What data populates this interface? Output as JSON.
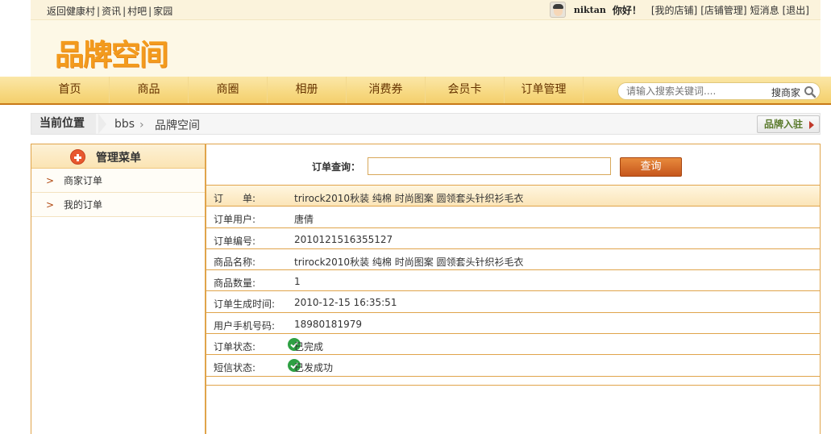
{
  "topbar": {
    "links": [
      "返回健康村",
      "资讯",
      "村吧",
      "家园"
    ],
    "username": "niktan",
    "greeting": "你好！",
    "user_links": [
      "[我的店铺]",
      "[店铺管理]",
      "短消息",
      "[退出]"
    ]
  },
  "header": {
    "logo_text": "品牌空间"
  },
  "nav": {
    "items": [
      "首页",
      "商品",
      "商圈",
      "相册",
      "消费券",
      "会员卡",
      "订单管理"
    ],
    "search_placeholder": "请输入搜索关键词....",
    "search_button": "搜商家"
  },
  "breadcrumb": {
    "current_label": "当前位置",
    "items": [
      "bbs",
      "品牌空间"
    ],
    "brand_button": "品牌入驻"
  },
  "sidebar": {
    "title": "管理菜单",
    "items": [
      "商家订单",
      "我的订单"
    ]
  },
  "query": {
    "label": "订单查询：",
    "value": "",
    "button": "查询"
  },
  "order": {
    "rows": [
      {
        "key": "订　　单:",
        "value": "trirock2010秋装 纯棉 时尚图案 圆领套头针织衫毛衣"
      },
      {
        "key": "订单用户:",
        "value": "唐倩"
      },
      {
        "key": "订单编号:",
        "value": "2010121516355127"
      },
      {
        "key": "商品名称:",
        "value": "trirock2010秋装 纯棉 时尚图案 圆领套头针织衫毛衣"
      },
      {
        "key": "商品数量:",
        "value": "1"
      },
      {
        "key": "订单生成时间:",
        "value": "2010-12-15 16:35:51"
      },
      {
        "key": "用户手机号码:",
        "value": "18980181979"
      },
      {
        "key": "订单状态:",
        "value": "已完成"
      },
      {
        "key": "短信状态:",
        "value": "已发成功"
      }
    ]
  },
  "colors": {
    "accent": "#f39b1d",
    "nav_border": "#c87a18",
    "table_border": "#e0a44b"
  }
}
